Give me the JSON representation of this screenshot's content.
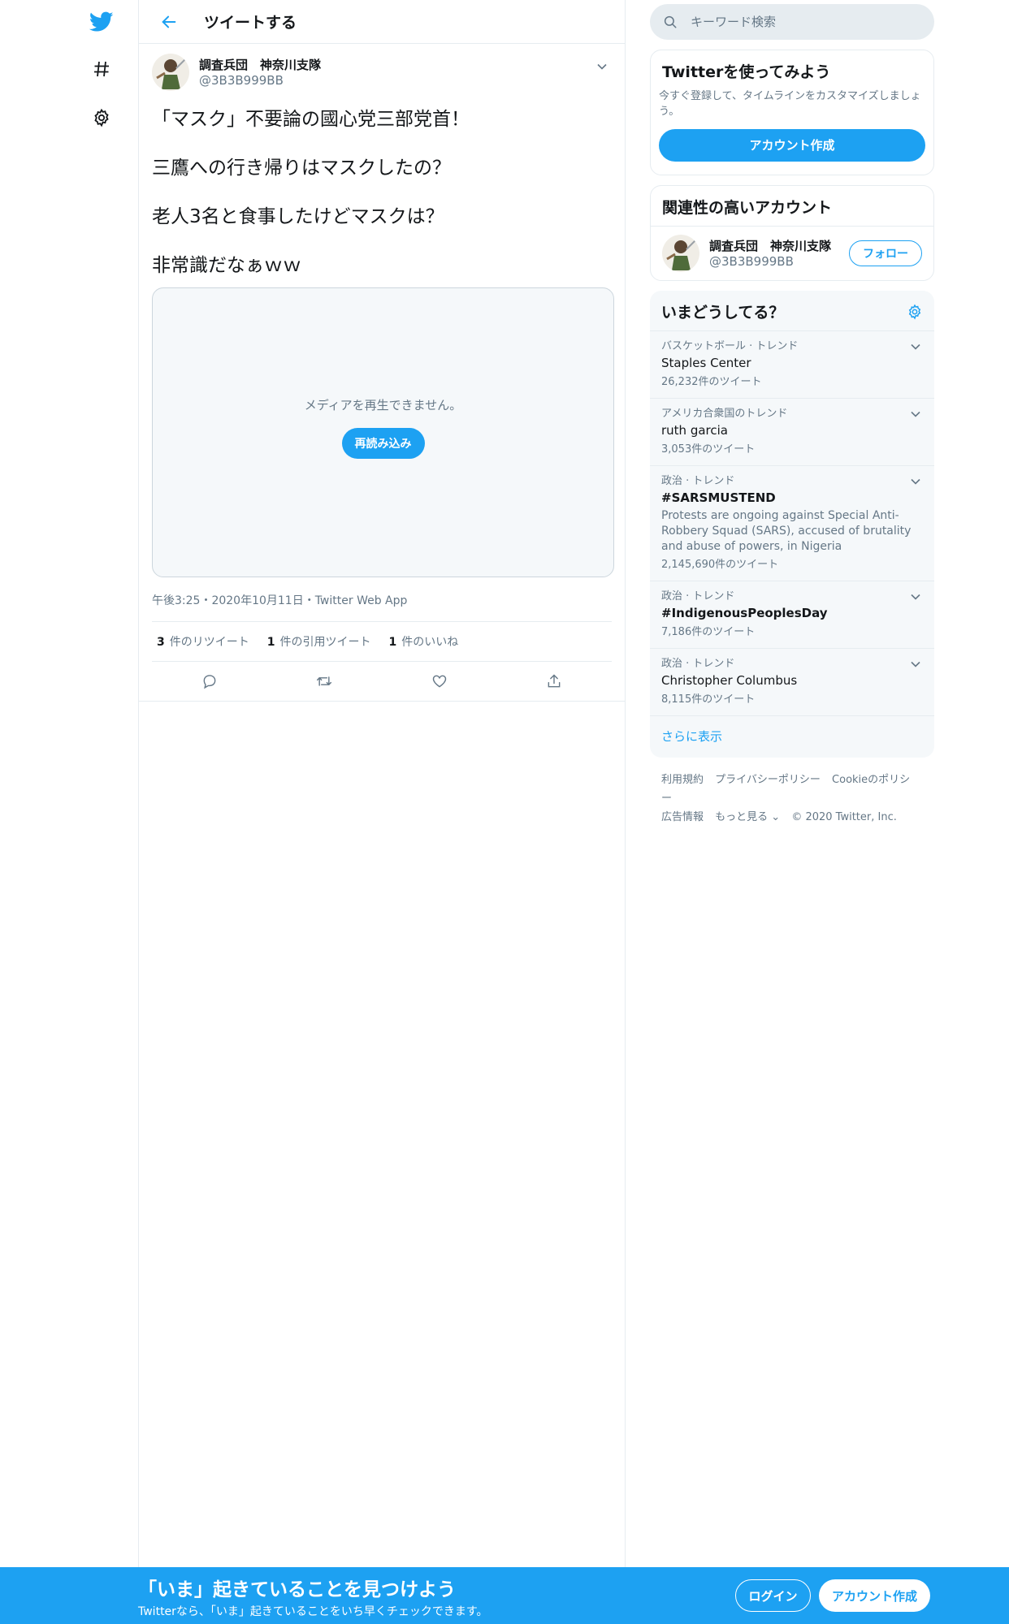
{
  "nav": {
    "items": [
      "twitter-logo",
      "explore-hashtag",
      "settings-gear"
    ]
  },
  "main": {
    "header_title": "ツイートする",
    "tweet": {
      "author_name": "調査兵団　神奈川支隊",
      "author_handle": "@3B3B999BB",
      "text_lines": [
        "「マスク」不要論の國心党三部党首！",
        "三鷹への行き帰りはマスクしたの？",
        "老人3名と食事したけどマスクは？",
        "非常識だなぁｗｗ"
      ],
      "media_message": "メディアを再生できません。",
      "media_reload_label": "再読み込み",
      "meta": "午後3:25・2020年10月11日・Twitter Web App",
      "stats": [
        {
          "count": "3",
          "label": "件のリツイート"
        },
        {
          "count": "1",
          "label": "件の引用ツイート"
        },
        {
          "count": "1",
          "label": "件のいいね"
        }
      ]
    }
  },
  "sidebar": {
    "search_placeholder": "キーワード検索",
    "signup_card": {
      "title": "Twitterを使ってみよう",
      "description": "今すぐ登録して、タイムラインをカスタマイズしましょう。",
      "button_label": "アカウント作成"
    },
    "related": {
      "title": "関連性の高いアカウント",
      "name": "調査兵団　神奈川支隊",
      "handle": "@3B3B999BB",
      "follow_label": "フォロー"
    },
    "trends": {
      "title": "いまどうしてる？",
      "items": [
        {
          "category": "バスケットボール · トレンド",
          "name": "Staples Center",
          "desc": "",
          "count": "26,232件のツイート"
        },
        {
          "category": "アメリカ合衆国のトレンド",
          "name": "ruth garcia",
          "desc": "",
          "count": "3,053件のツイート"
        },
        {
          "category": "政治 · トレンド",
          "name": "#SARSMUSTEND",
          "desc": "Protests are ongoing against Special Anti-Robbery Squad (SARS), accused of brutality and abuse of powers, in Nigeria",
          "count": "2,145,690件のツイート"
        },
        {
          "category": "政治 · トレンド",
          "name": "#IndigenousPeoplesDay",
          "desc": "",
          "count": "7,186件のツイート"
        },
        {
          "category": "政治 · トレンド",
          "name": "Christopher Columbus",
          "desc": "",
          "count": "8,115件のツイート"
        }
      ],
      "show_more": "さらに表示"
    },
    "footer": {
      "links_row1": [
        "利用規約",
        "プライバシーポリシー",
        "Cookieのポリシー"
      ],
      "links_row2": [
        "広告情報",
        "もっと見る ⌄",
        "© 2020 Twitter, Inc."
      ]
    }
  },
  "bottom_bar": {
    "title": "「いま」起きていることを見つけよう",
    "subtitle": "Twitterなら、「いま」起きていることをいち早くチェックできます。",
    "login_label": "ログイン",
    "signup_label": "アカウント作成"
  },
  "colors": {
    "accent": "#1da1f2",
    "secondary_text": "#657786",
    "border": "#e6ecf0"
  }
}
